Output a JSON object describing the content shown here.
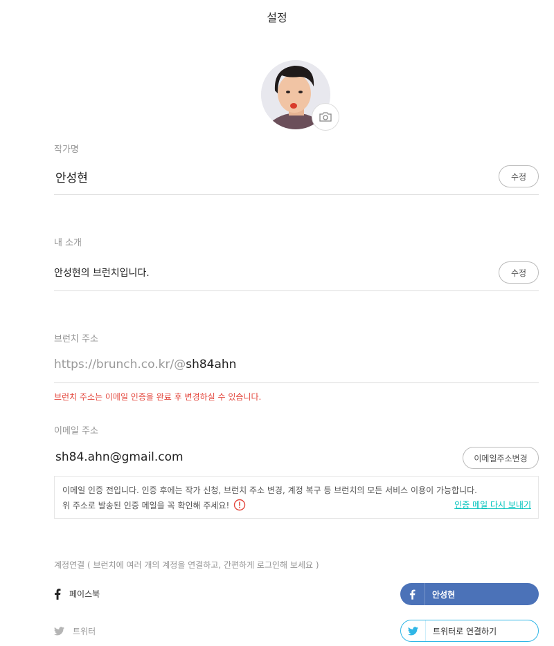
{
  "page": {
    "title": "설정"
  },
  "profile": {
    "avatar_alt": "profile photo",
    "camera_icon": "camera-icon"
  },
  "author_name": {
    "label": "작가명",
    "value": "안성현",
    "edit_label": "수정"
  },
  "intro": {
    "label": "내 소개",
    "value": "안성현의 브런치입니다.",
    "edit_label": "수정"
  },
  "brunch_address": {
    "label": "브런치 주소",
    "prefix": "https://brunch.co.kr/@",
    "id": "sh84ahn",
    "warning": "브런치 주소는 이메일 인증을 완료 후 변경하실 수 있습니다."
  },
  "email": {
    "label": "이메일 주소",
    "value": "sh84.ahn@gmail.com",
    "change_label": "이메일주소변경",
    "notice_line1": "이메일 인증 전입니다. 인증 후에는 작가 신청, 브런치 주소 변경, 계정 복구 등 브런치의 모든 서비스 이용이 가능합니다.",
    "notice_line2": "위 주소로 발송된 인증 메일을 꼭 확인해 주세요!",
    "resend_label": "인증 메일 다시 보내기"
  },
  "accounts": {
    "label": "계정연결 ( 브런치에 여러 개의 계정을 연결하고, 간편하게 로그인해 보세요 )",
    "facebook": {
      "name": "페이스북",
      "button_label": "안성현",
      "color": "#4b72b8"
    },
    "twitter": {
      "name": "트위터",
      "button_label": "트위터로 연결하기",
      "color": "#30b6e6"
    }
  },
  "colors": {
    "accent": "#00c3bd",
    "warning": "#e3463c"
  }
}
